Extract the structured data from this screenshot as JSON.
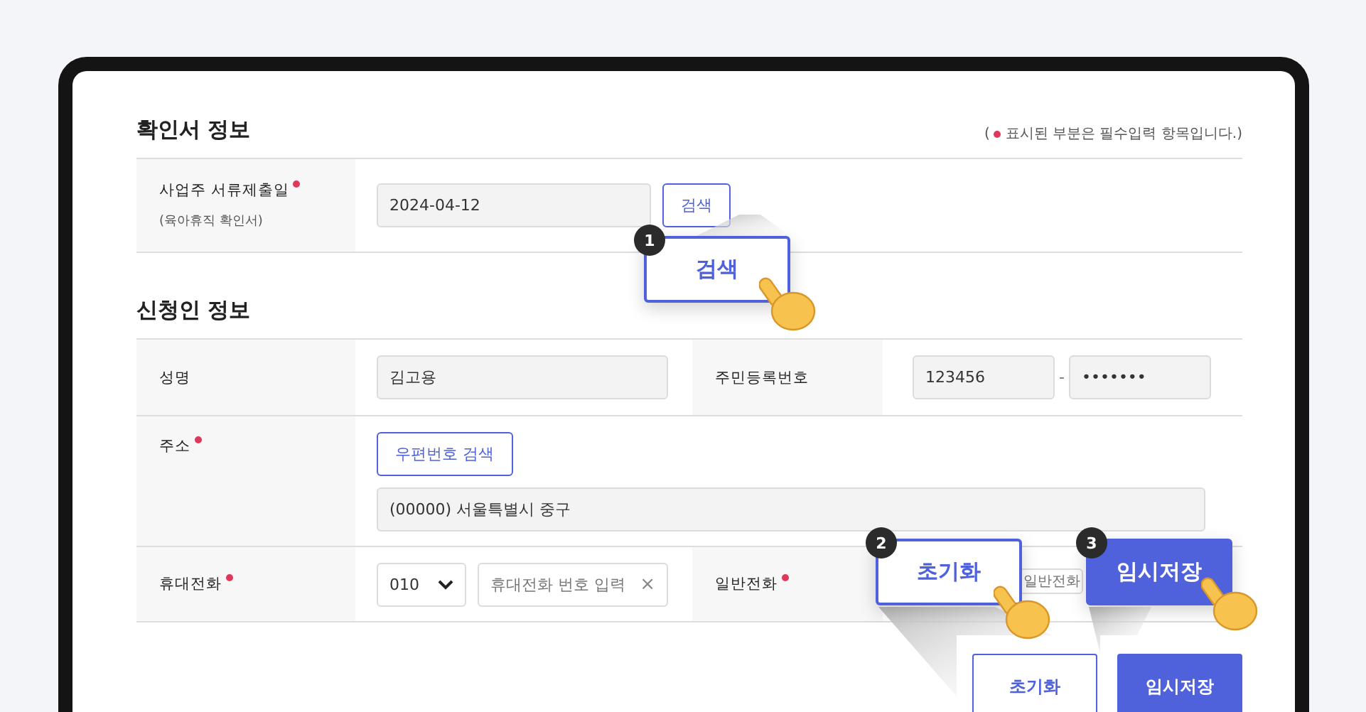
{
  "confirm_section": {
    "title": "확인서 정보",
    "note_open": "(",
    "note": "표시된 부분은 필수입력 항목입니다.)",
    "row": {
      "label": "사업주 서류제출일",
      "sublabel": "(육아휴직 확인서)",
      "required": true,
      "value": "2024-04-12",
      "button": "검색"
    }
  },
  "applicant_section": {
    "title": "신청인 정보",
    "name": {
      "label": "성명",
      "required": false,
      "value": "김고용"
    },
    "resident_number": {
      "label": "주민등록번호",
      "required": false,
      "front": "123456",
      "separator": "-",
      "back": "•••••••"
    },
    "address": {
      "label": "주소",
      "required": true,
      "button": "우편번호 검색",
      "value": "(00000) 서울특별시 중구"
    },
    "mobile": {
      "label": "휴대전화",
      "required": true,
      "prefix": "010",
      "placeholder": "휴대전화 번호 입력",
      "clear": "×"
    },
    "phone": {
      "label": "일반전화",
      "required": true,
      "placeholder": "일반전화"
    }
  },
  "actions": [
    {
      "label": "초기화",
      "kind": "outline"
    },
    {
      "label": "임시저장",
      "kind": "filled"
    }
  ],
  "callouts": [
    {
      "number": "1",
      "label": "검색",
      "kind": "outline"
    },
    {
      "number": "2",
      "label": "초기화",
      "kind": "outline"
    },
    {
      "number": "3",
      "label": "임시저장",
      "kind": "filled"
    }
  ]
}
